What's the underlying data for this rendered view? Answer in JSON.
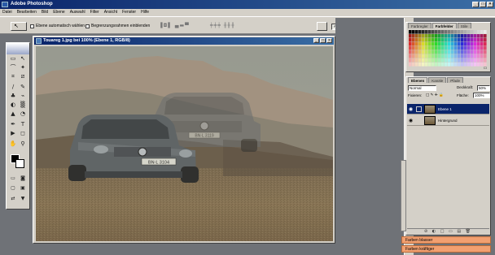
{
  "app": {
    "title": "Adobe Photoshop",
    "window_buttons": [
      "_",
      "□",
      "×"
    ]
  },
  "menu": [
    "Datei",
    "Bearbeiten",
    "Bild",
    "Ebene",
    "Auswahl",
    "Filter",
    "Ansicht",
    "Fenster",
    "Hilfe"
  ],
  "options": {
    "auto_select": "Ebene automatisch wählen",
    "show_bounds": "Begrenzungsrahmen einblenden",
    "align_glyphs_1": "▐◘▌ ▄▬▀",
    "align_glyphs_2": "╪╪╪ ╫╫╫",
    "palette_wells": [
      "Pinsel",
      "WZ-Vorg.",
      "Ebenenkomp."
    ]
  },
  "tools": {
    "icons": [
      "move-icon",
      "marquee-icon",
      "lasso-icon",
      "crop-icon",
      "brush-icon",
      "stamp-icon",
      "eraser-icon",
      "gradient-icon",
      "pen-icon",
      "type-icon",
      "hand-icon",
      "zoom-icon"
    ],
    "glyphs": [
      "↖",
      "▭",
      "⌒",
      "✦",
      "⌗",
      "⧄",
      "∕",
      "✎",
      "♣",
      "⌁",
      "◐",
      "▒",
      "▲",
      "◔",
      "✒",
      "T",
      "▶",
      "◻",
      "✋",
      "⚲"
    ],
    "colors": {
      "foreground": "#000000",
      "background": "#ffffff"
    }
  },
  "document": {
    "title": "Touareg 1.jpg bei 100% (Ebene 1, RGB/8)",
    "plate_front": "BN·L 3104",
    "plate_back": "BN·L 3119"
  },
  "swatches_panel": {
    "tabs": [
      "Farbregler",
      "Farbfelder",
      "Stile"
    ],
    "active_tab": 1
  },
  "layers_panel": {
    "tabs": [
      "Ebenen",
      "Kanäle",
      "Pfade"
    ],
    "active_tab": 0,
    "blend_mode": "Normal",
    "opacity_label": "Deckkraft:",
    "opacity_value": "50%",
    "lock_label": "Fixieren:",
    "lock_glyphs": "□ ✎ ✛ 🔒",
    "fill_label": "Fläche:",
    "fill_value": "100%",
    "layers": [
      {
        "name": "Ebene 1",
        "selected": true
      },
      {
        "name": "Hintergrund",
        "selected": false
      }
    ],
    "bottom_glyphs": "⊘ ◐ □ ▭ ▤ 🗑"
  },
  "actions": [
    "Farben blasser",
    "Farben kräftiger"
  ],
  "ui_colors": {
    "titlebar": "#0a246a",
    "chrome": "#d4d0c8",
    "action_highlight": "#f2a070"
  }
}
